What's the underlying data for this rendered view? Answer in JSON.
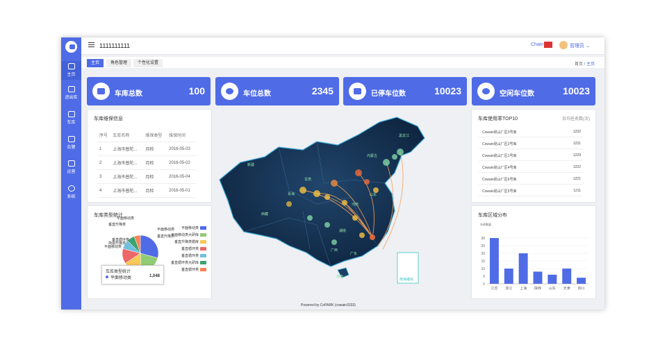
{
  "app": {
    "title": "1111111111",
    "chain_label": "Chain",
    "user": "管理员"
  },
  "sidebar": {
    "items": [
      {
        "label": "主页",
        "icon": "home-icon",
        "active": true
      },
      {
        "label": "进出库",
        "icon": "inout-icon"
      },
      {
        "label": "车库",
        "icon": "garage-icon"
      },
      {
        "label": "告警",
        "icon": "alarm-icon"
      },
      {
        "label": "运营",
        "icon": "operation-icon"
      },
      {
        "label": "系统",
        "icon": "gear-icon"
      }
    ]
  },
  "tabs": [
    {
      "label": "主页",
      "active": true
    },
    {
      "label": "角色管理"
    },
    {
      "label": "个性化设置"
    }
  ],
  "breadcrumb": {
    "home": "首页",
    "sep": "/",
    "current": "主页"
  },
  "stats": [
    {
      "label": "车库总数",
      "value": "100",
      "icon": "garage-icon"
    },
    {
      "label": "车位总数",
      "value": "2345",
      "icon": "parking-icon"
    },
    {
      "label": "已停车位数",
      "value": "10023",
      "icon": "car-icon"
    },
    {
      "label": "空闲车位数",
      "value": "10023",
      "icon": "circle-icon"
    }
  ],
  "maintenance": {
    "title": "车库维保信息",
    "headers": [
      "序号",
      "车库名称",
      "维保类型",
      "维保时间"
    ],
    "rows": [
      [
        "1",
        "上海市普陀...",
        "月检",
        "2016-05-03"
      ],
      [
        "2",
        "上海市普陀...",
        "月检",
        "2016-05-02"
      ],
      [
        "3",
        "上海市普陀...",
        "月检",
        "2016-05-04"
      ],
      [
        "4",
        "上海市普陀...",
        "月检",
        "2016-05-01"
      ]
    ]
  },
  "pie": {
    "title": "车库类型统计",
    "labels": [
      "平面移动类",
      "垂直升降类",
      "垂直循环类",
      "简易升降类",
      "平面移动类",
      "平面移动类",
      "垂直升降类"
    ],
    "legend": [
      "平面移动类",
      "平面移动类大研库",
      "垂直升降类循库",
      "垂直循环类",
      "垂直循环类",
      "垂直循环类大研库",
      "垂直循环类"
    ],
    "colors": [
      "#4f6be6",
      "#91cc75",
      "#fac858",
      "#ee6666",
      "#73c0de",
      "#3ba272",
      "#fc8452"
    ],
    "tooltip": {
      "title": "车库类型统计",
      "name": "平面移动类",
      "value": "1,048"
    }
  },
  "chart_data": [
    {
      "type": "pie",
      "title": "车库类型统计",
      "slices": [
        {
          "name": "平面移动类",
          "value": 1048
        },
        {
          "name": "垂直升降类",
          "value": 735
        },
        {
          "name": "垂直循环类",
          "value": 580
        },
        {
          "name": "简易升降类",
          "value": 484
        },
        {
          "name": "平面移动类",
          "value": 300
        },
        {
          "name": "平面移动类",
          "value": 250
        },
        {
          "name": "垂直升降类",
          "value": 200
        }
      ]
    },
    {
      "type": "bar",
      "title": "车库区域分布",
      "ylabel": "车库数量",
      "categories": [
        "江苏",
        "浙江",
        "上海",
        "陕西",
        "山东",
        "天津",
        "四川"
      ],
      "values": [
        30,
        10,
        20,
        8,
        6,
        10,
        4
      ],
      "ylim": [
        0,
        30
      ],
      "yticks": [
        0,
        5,
        10,
        15,
        20,
        25,
        30
      ],
      "color": "#4f6be6"
    }
  ],
  "top10": {
    "title": "车库使用率TOP10",
    "subtitle": "日均任务数(次)",
    "rows": [
      {
        "name": "Cowain昆山厂区3号库",
        "value": "1232"
      },
      {
        "name": "Cowain昆山厂区2号库",
        "value": "1231"
      },
      {
        "name": "Cowain昆山厂区1号库",
        "value": "1229"
      },
      {
        "name": "Cowain昆山厂区4号库",
        "value": "1222"
      },
      {
        "name": "Cowain昆山厂区6号库",
        "value": "1221"
      },
      {
        "name": "Cowain昆山厂区5号库",
        "value": "1211"
      }
    ]
  },
  "bar": {
    "title": "车库区域分布",
    "ylabel": "车库数量"
  },
  "map": {
    "provinces": [
      "黑龙江",
      "内蒙古",
      "新疆",
      "西藏",
      "青海",
      "甘肃",
      "河南",
      "山东",
      "广东",
      "广西",
      "湖南",
      "海南"
    ],
    "inset": "南海诸岛"
  },
  "footer": {
    "powered": "Powered by CoPARK (cowain3333)"
  }
}
